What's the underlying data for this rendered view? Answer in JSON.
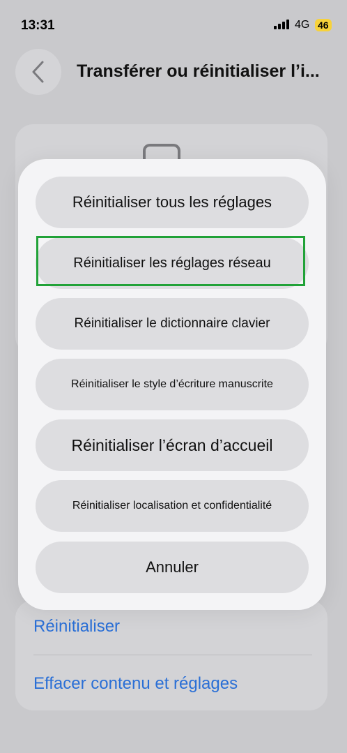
{
  "status_bar": {
    "time": "13:31",
    "network": "4G",
    "battery": "46"
  },
  "nav": {
    "title": "Transférer ou réinitialiser l’i..."
  },
  "action_sheet": {
    "options": [
      {
        "label": "Réinitialiser tous les réglages"
      },
      {
        "label": "Réinitialiser les réglages réseau"
      },
      {
        "label": "Réinitialiser le dictionnaire clavier"
      },
      {
        "label": "Réinitialiser le style d’écriture manuscrite"
      },
      {
        "label": "Réinitialiser l’écran d’accueil"
      },
      {
        "label": "Réinitialiser localisation et confidentialité"
      }
    ],
    "cancel_label": "Annuler"
  },
  "background": {
    "reset_label": "Réinitialiser",
    "erase_label": "Effacer contenu et réglages"
  },
  "colors": {
    "link": "#2a6fd6",
    "highlight": "#21a238",
    "battery": "#f7d23a"
  },
  "icons": {
    "back": "chevron-left-icon",
    "signal": "signal-bars-icon",
    "device": "phone-icon"
  }
}
